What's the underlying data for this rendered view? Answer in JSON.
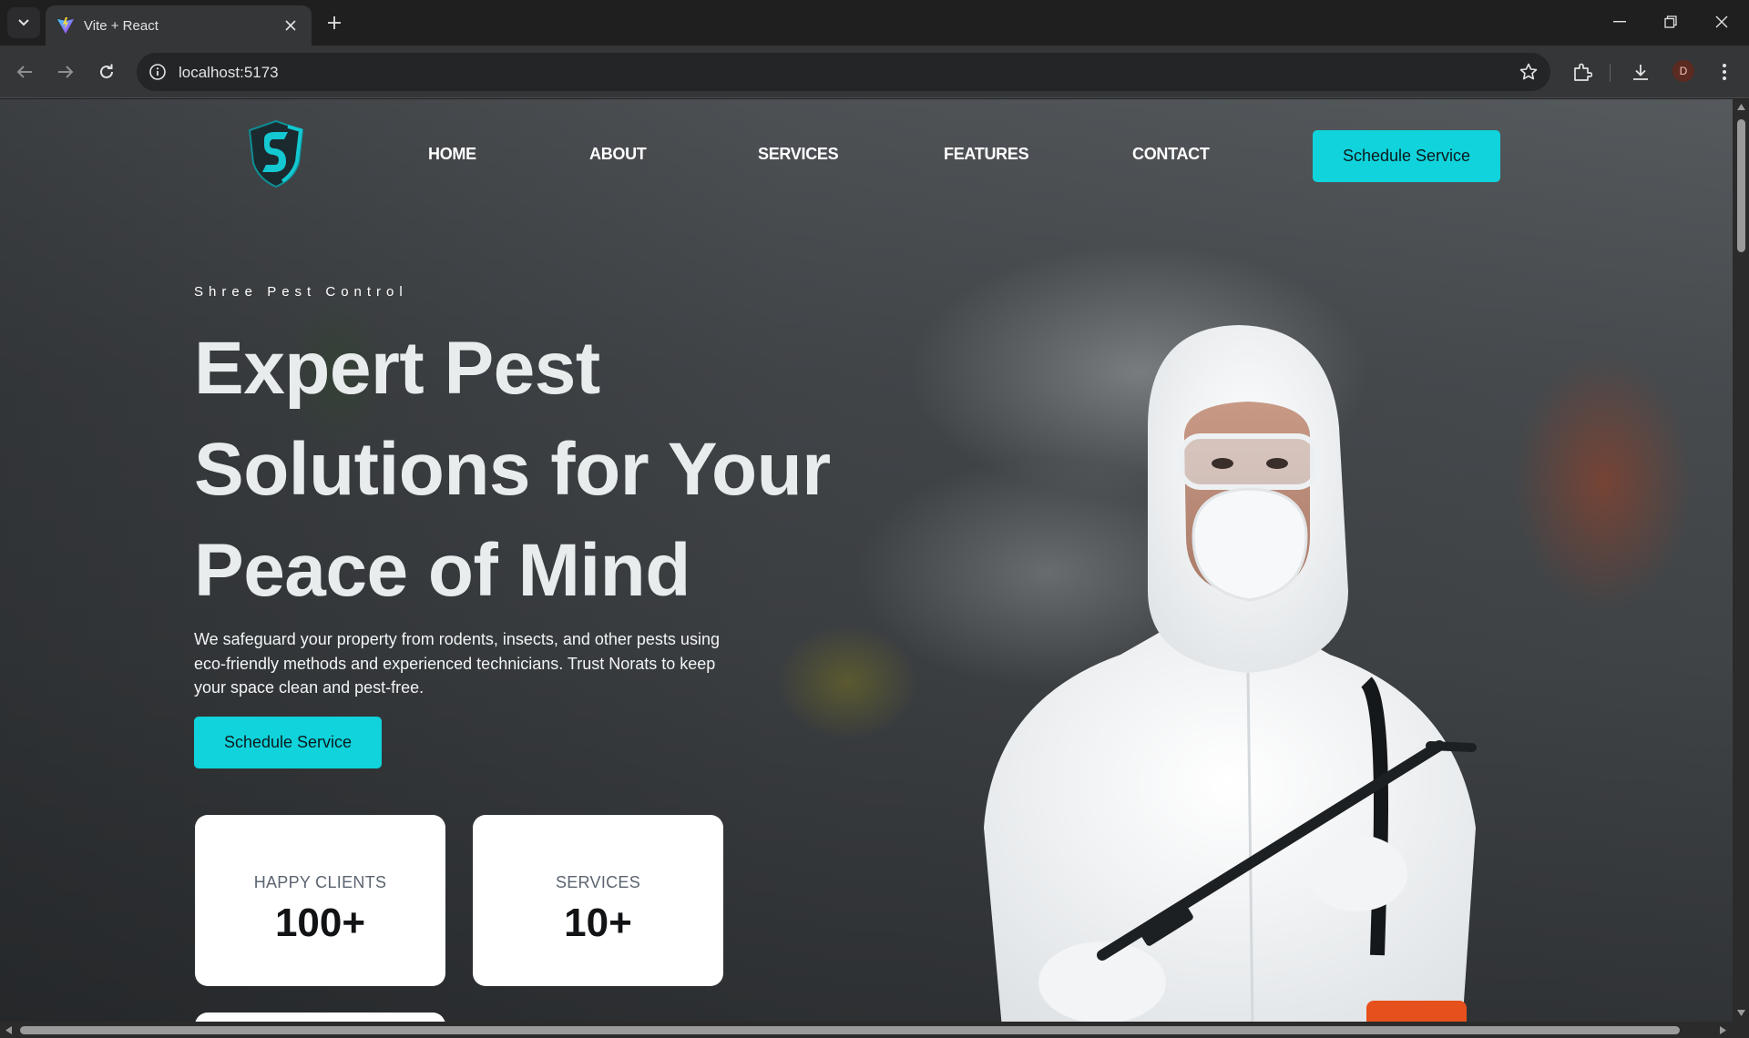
{
  "browser": {
    "tab_title": "Vite + React",
    "url": "localhost:5173",
    "profile_initial": "D"
  },
  "nav": {
    "links": [
      "HOME",
      "ABOUT",
      "SERVICES",
      "FEATURES",
      "CONTACT"
    ],
    "cta_label": "Schedule Service"
  },
  "hero": {
    "eyebrow": "Shree Pest Control",
    "headline_lines": [
      "Expert Pest",
      "Solutions for Your",
      "Peace of Mind"
    ],
    "description": "We safeguard your property from rodents, insects, and other pests using eco-friendly methods and experienced technicians. Trust Norats to keep your space clean and pest-free.",
    "cta_label": "Schedule Service"
  },
  "stats": [
    {
      "label": "HAPPY CLIENTS",
      "value": "100+"
    },
    {
      "label": "SERVICES",
      "value": "10+"
    }
  ],
  "colors": {
    "accent": "#10d3dc",
    "card_bg": "#ffffff"
  }
}
